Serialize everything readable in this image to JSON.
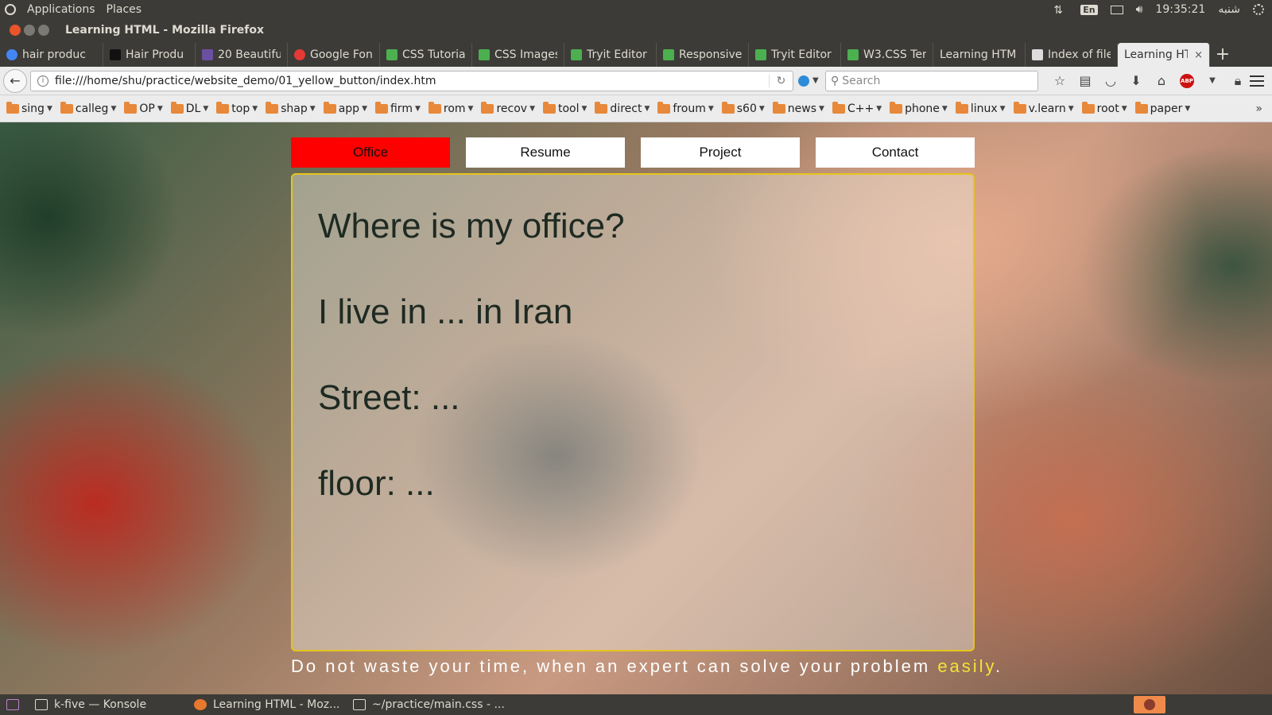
{
  "top_panel": {
    "menus": [
      "Applications",
      "Places"
    ],
    "keyboard_layout": "En",
    "clock": "19:35:21",
    "day": "شنبه"
  },
  "window": {
    "title": "Learning HTML - Mozilla Firefox"
  },
  "tabs": [
    {
      "label": "hair produc",
      "favicon_color": "#4285f4"
    },
    {
      "label": "Hair Produ",
      "favicon_color": "#111111"
    },
    {
      "label": "20 Beautifu",
      "favicon_color": "#6b4fa0"
    },
    {
      "label": "Google Fon",
      "favicon_color": "#e53935"
    },
    {
      "label": "CSS Tutoria",
      "favicon_color": "#4caf50"
    },
    {
      "label": "CSS Images",
      "favicon_color": "#4caf50"
    },
    {
      "label": "Tryit Editor",
      "favicon_color": "#4caf50"
    },
    {
      "label": "Responsive",
      "favicon_color": "#4caf50"
    },
    {
      "label": "Tryit Editor",
      "favicon_color": "#4caf50"
    },
    {
      "label": "W3.CSS Ten",
      "favicon_color": "#4caf50"
    },
    {
      "label": "Learning HTM",
      "favicon_color": ""
    },
    {
      "label": "Index of file",
      "favicon_color": "#dddddd"
    }
  ],
  "active_tab": {
    "label": "Learning HT",
    "close": "×"
  },
  "new_tab": "+",
  "nav": {
    "url": "file:///home/shu/practice/website_demo/01_yellow_button/index.htm",
    "search_placeholder": "Search"
  },
  "bookmarks": [
    "sing",
    "calleg",
    "OP",
    "DL",
    "top",
    "shap",
    "app",
    "firm",
    "rom",
    "recov",
    "tool",
    "direct",
    "froum",
    "s60",
    "news",
    "C++",
    "phone",
    "linux",
    "v.learn",
    "root",
    "paper"
  ],
  "bookmarks_overflow": "»",
  "site": {
    "nav_buttons": [
      {
        "label": "Office",
        "active": true
      },
      {
        "label": "Resume",
        "active": false
      },
      {
        "label": "Project",
        "active": false
      },
      {
        "label": "Contact",
        "active": false
      }
    ],
    "lines": [
      "Where is my office?",
      "I live in ... in Iran",
      "Street: ...",
      "floor: ..."
    ],
    "tagline_main": "Do not waste your time, when an expert can solve your problem ",
    "tagline_highlight": "easily",
    "tagline_end": ".",
    "colors": {
      "active_button": "#ff0000",
      "box_border": "#e6c51a",
      "highlight": "#f3e33a"
    }
  },
  "taskbar": {
    "tasks": [
      {
        "label": "k-five — Konsole",
        "icon_color": "#5a5a5a"
      },
      {
        "label": "Learning HTML - Moz...",
        "icon_color": "#e8782e"
      },
      {
        "label": "~/practice/main.css - ...",
        "icon_color": "#6a6a6a"
      }
    ]
  }
}
